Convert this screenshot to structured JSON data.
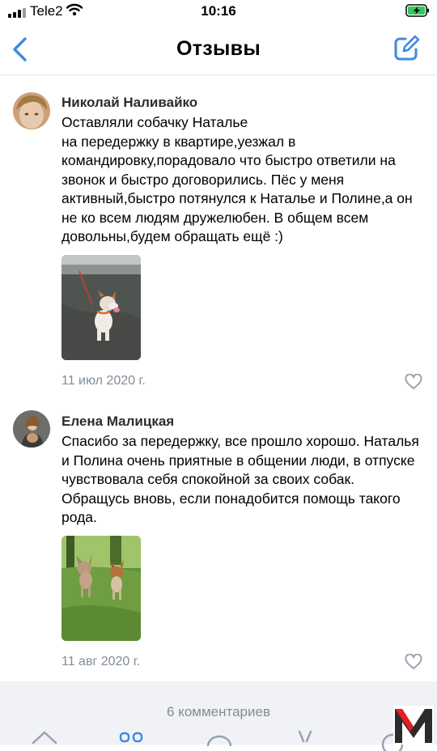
{
  "status": {
    "carrier": "Tele2",
    "time": "10:16"
  },
  "nav": {
    "title": "Отзывы"
  },
  "reviews": [
    {
      "author": "Николай Наливайко",
      "text": "Оставляли собачку Наталье\nна передержку в квартире,уезжал в командировку,порадовало что быстро ответили на звонок и быстро договорились. Пёс у меня активный,быстро потянулся к Наталье и Полине,а он не ко всем людям дружелюбен. В общем всем довольны,будем обращать ещё :)",
      "date": "11 июл 2020 г."
    },
    {
      "author": "Елена Малицкая",
      "text": "Спасибо за передержку, все прошло хорошо. Наталья и Полина очень приятные в общении люди, в отпуске чувствовала себя спокойной за своих собак. Обращусь вновь, если понадобится помощь такого рода.",
      "date": "11 авг 2020 г."
    }
  ],
  "footer": {
    "comments_count": "6 комментариев"
  },
  "colors": {
    "accent": "#3f8ae0",
    "secondary_text": "#818c99",
    "footer_bg": "#f0f2f5",
    "logo_red": "#e31e24"
  }
}
